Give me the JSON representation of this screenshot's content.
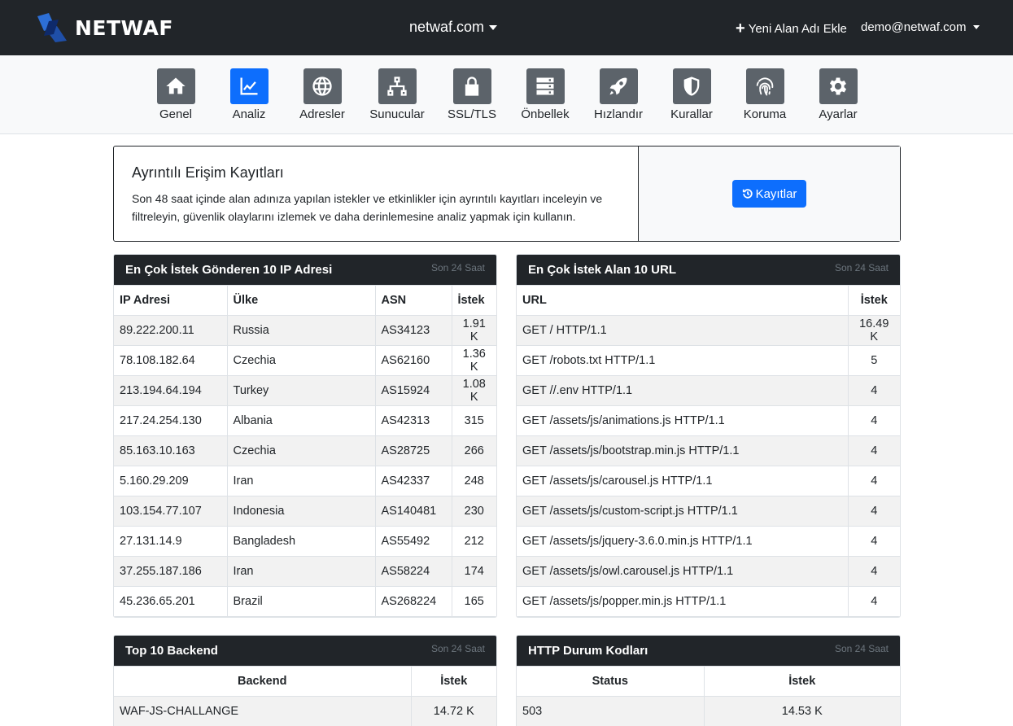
{
  "header": {
    "brand": "NETWAF",
    "domain": "netwaf.com",
    "add_domain": "Yeni Alan Adı Ekle",
    "user": "demo@netwaf.com"
  },
  "nav": {
    "items": [
      {
        "label": "Genel",
        "icon": "home-icon"
      },
      {
        "label": "Analiz",
        "icon": "chart-icon",
        "active": true
      },
      {
        "label": "Adresler",
        "icon": "globe-icon"
      },
      {
        "label": "Sunucular",
        "icon": "network-icon"
      },
      {
        "label": "SSL/TLS",
        "icon": "lock-icon"
      },
      {
        "label": "Önbellek",
        "icon": "server-icon"
      },
      {
        "label": "Hızlandır",
        "icon": "rocket-icon"
      },
      {
        "label": "Kurallar",
        "icon": "shield-icon"
      },
      {
        "label": "Koruma",
        "icon": "fingerprint-icon"
      },
      {
        "label": "Ayarlar",
        "icon": "gear-icon"
      }
    ]
  },
  "logs": {
    "title": "Ayrıntılı Erişim Kayıtları",
    "description": "Son 48 saat içinde alan adınıza yapılan istekler ve etkinlikler için ayrıntılı kayıtları inceleyin ve filtreleyin, güvenlik olaylarını izlemek ve daha derinlemesine analiz yapmak için kullanın.",
    "button": "Kayıtlar"
  },
  "top_ips": {
    "title": "En Çok İstek Gönderen 10 IP Adresi",
    "period": "Son 24 Saat",
    "columns": [
      "IP Adresi",
      "Ülke",
      "ASN",
      "İstek"
    ],
    "rows": [
      [
        "89.222.200.11",
        "Russia",
        "AS34123",
        "1.91 K"
      ],
      [
        "78.108.182.64",
        "Czechia",
        "AS62160",
        "1.36 K"
      ],
      [
        "213.194.64.194",
        "Turkey",
        "AS15924",
        "1.08 K"
      ],
      [
        "217.24.254.130",
        "Albania",
        "AS42313",
        "315"
      ],
      [
        "85.163.10.163",
        "Czechia",
        "AS28725",
        "266"
      ],
      [
        "5.160.29.209",
        "Iran",
        "AS42337",
        "248"
      ],
      [
        "103.154.77.107",
        "Indonesia",
        "AS140481",
        "230"
      ],
      [
        "27.131.14.9",
        "Bangladesh",
        "AS55492",
        "212"
      ],
      [
        "37.255.187.186",
        "Iran",
        "AS58224",
        "174"
      ],
      [
        "45.236.65.201",
        "Brazil",
        "AS268224",
        "165"
      ]
    ]
  },
  "top_urls": {
    "title": "En Çok İstek Alan 10 URL",
    "period": "Son 24 Saat",
    "columns": [
      "URL",
      "İstek"
    ],
    "rows": [
      [
        "GET / HTTP/1.1",
        "16.49 K"
      ],
      [
        "GET /robots.txt HTTP/1.1",
        "5"
      ],
      [
        "GET //.env HTTP/1.1",
        "4"
      ],
      [
        "GET /assets/js/animations.js HTTP/1.1",
        "4"
      ],
      [
        "GET /assets/js/bootstrap.min.js HTTP/1.1",
        "4"
      ],
      [
        "GET /assets/js/carousel.js HTTP/1.1",
        "4"
      ],
      [
        "GET /assets/js/custom-script.js HTTP/1.1",
        "4"
      ],
      [
        "GET /assets/js/jquery-3.6.0.min.js HTTP/1.1",
        "4"
      ],
      [
        "GET /assets/js/owl.carousel.js HTTP/1.1",
        "4"
      ],
      [
        "GET /assets/js/popper.min.js HTTP/1.1",
        "4"
      ]
    ]
  },
  "top_backend": {
    "title": "Top 10 Backend",
    "period": "Son 24 Saat",
    "columns": [
      "Backend",
      "İstek"
    ],
    "rows": [
      [
        "WAF-JS-CHALLANGE",
        "14.72 K"
      ]
    ]
  },
  "status_codes": {
    "title": "HTTP Durum Kodları",
    "period": "Son 24 Saat",
    "columns": [
      "Status",
      "İstek"
    ],
    "rows": [
      [
        "503",
        "14.53 K"
      ]
    ]
  }
}
